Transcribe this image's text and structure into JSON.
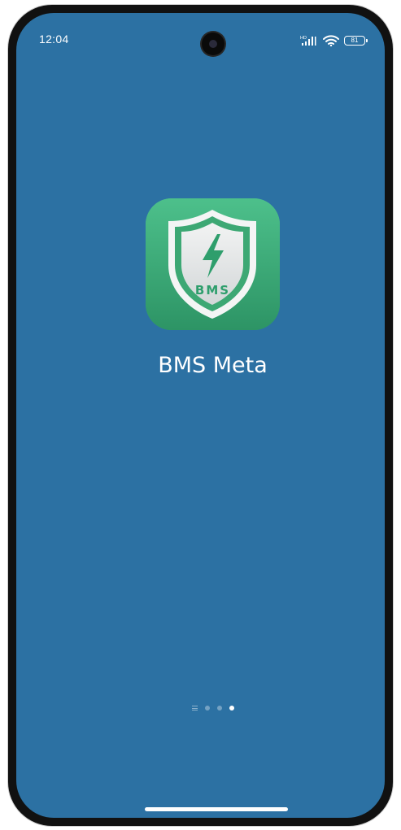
{
  "status_bar": {
    "time": "12:04",
    "battery": "81",
    "network_label": "HD",
    "icons": [
      "signal-icon",
      "wifi-icon",
      "battery-icon"
    ]
  },
  "wallpaper": {
    "color": "#2c71a3"
  },
  "app": {
    "name": "BMS Meta",
    "icon_text": "BMS",
    "icon_colors": {
      "tile": "#3fab78",
      "shield_bg": "#e4e6e7",
      "accent": "#2e9e6c"
    }
  },
  "page_indicator": {
    "pages": 3,
    "active_index": 2
  }
}
